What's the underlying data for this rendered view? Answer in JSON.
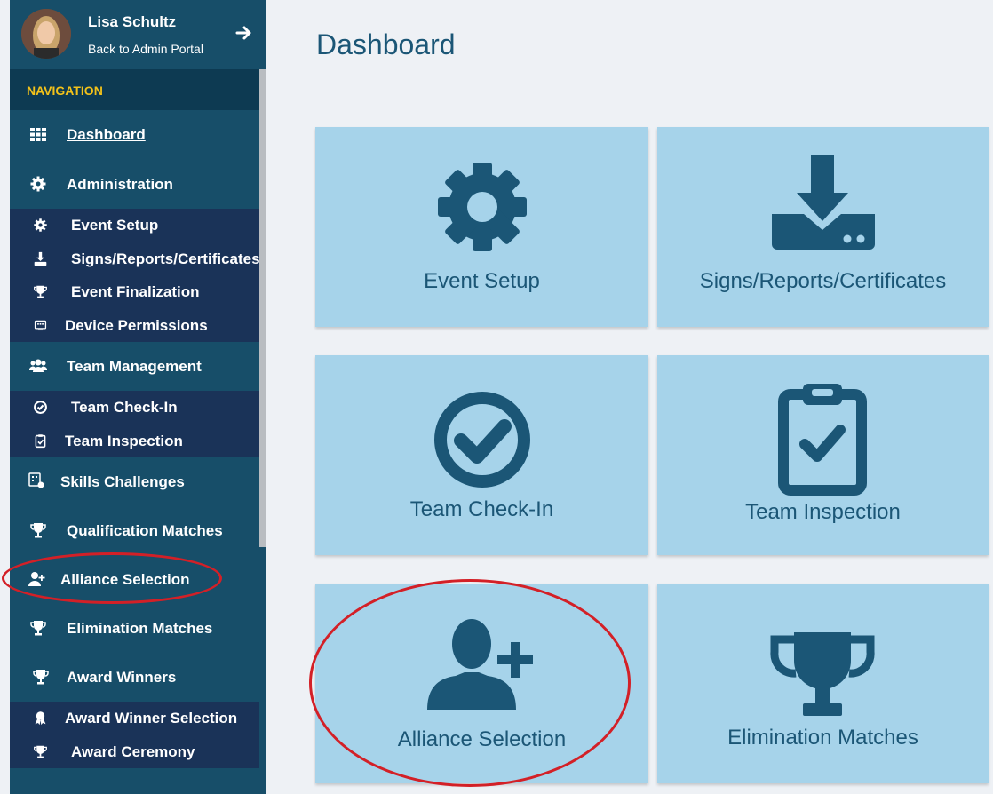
{
  "profile": {
    "name": "Lisa Schultz",
    "back_link": "Back to Admin Portal"
  },
  "nav": {
    "header": "NAVIGATION",
    "dashboard": "Dashboard",
    "administration": "Administration",
    "admin_items": [
      "Event Setup",
      "Signs/Reports/Certificates",
      "Event Finalization",
      "Device Permissions"
    ],
    "team_management": "Team Management",
    "team_items": [
      "Team Check-In",
      "Team Inspection"
    ],
    "skills_challenges": "Skills Challenges",
    "qualification_matches": "Qualification Matches",
    "alliance_selection": "Alliance Selection",
    "elimination_matches": "Elimination Matches",
    "award_winners": "Award Winners",
    "award_items": [
      "Award Winner Selection",
      "Award Ceremony"
    ]
  },
  "main": {
    "title": "Dashboard",
    "tiles": [
      "Event Setup",
      "Signs/Reports/Certificates",
      "Team Check-In",
      "Team Inspection",
      "Alliance Selection",
      "Elimination Matches"
    ]
  },
  "colors": {
    "sidebar": "#174e69",
    "submenu": "#1a3358",
    "accent": "#f3c21a",
    "tile": "#a6d3ea",
    "icon": "#1b5676",
    "highlight": "#d32027"
  }
}
